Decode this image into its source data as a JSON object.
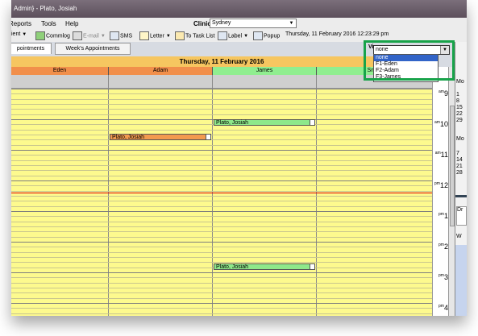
{
  "window": {
    "title": "Admin} - Plato, Josiah"
  },
  "menu": {
    "items": [
      "Reports",
      "Tools",
      "Help"
    ],
    "clinic_label": "Clinic:",
    "clinic_value": "Sydney"
  },
  "toolbar": {
    "patient": "ient",
    "commlog": "Commlog",
    "email": "E-mail",
    "sms": "SMS",
    "letter": "Letter",
    "tasklist": "To Task List",
    "label": "Label",
    "popup": "Popup",
    "datetime": "Thursday, 11 February 2016 12:23:29 pm"
  },
  "tabs": [
    {
      "label": "Appointments",
      "shown": "pointments",
      "active": true
    },
    {
      "label": "Week's Appointments",
      "active": false
    }
  ],
  "view": {
    "label": "View",
    "selected": "none",
    "options": [
      "none",
      "F1-Eden",
      "F2-Adam",
      "F3-James"
    ]
  },
  "schedule": {
    "date": "Thursday, 11 February 2016",
    "providers": [
      {
        "name": "Eden",
        "color": "#f18f4b"
      },
      {
        "name": "Adam",
        "color": "#f18f4b"
      },
      {
        "name": "James",
        "color": "#90ee90"
      },
      {
        "name": "Smith",
        "color": "#90ee90"
      }
    ],
    "times": [
      {
        "ap": "am",
        "h": "9"
      },
      {
        "ap": "am",
        "h": "10"
      },
      {
        "ap": "am",
        "h": "11"
      },
      {
        "ap": "pm",
        "h": "12"
      },
      {
        "ap": "pm",
        "h": "1"
      },
      {
        "ap": "pm",
        "h": "2"
      },
      {
        "ap": "pm",
        "h": "3"
      },
      {
        "ap": "pm",
        "h": "4"
      }
    ],
    "appointments": [
      {
        "patient": "Plato, Josiah",
        "provider": "James",
        "color": "#8ee88a"
      },
      {
        "patient": "Plato, Josiah",
        "provider": "Adam",
        "color": "#f29a4f"
      },
      {
        "patient": "Plato, Josiah",
        "provider": "James",
        "color": "#8ee88a"
      }
    ]
  },
  "right_panel": {
    "numbers": [
      "1",
      "8",
      "15",
      "22",
      "29",
      "7",
      "14",
      "21",
      "28"
    ],
    "labels": [
      "Mo",
      "Dr",
      "W"
    ]
  }
}
